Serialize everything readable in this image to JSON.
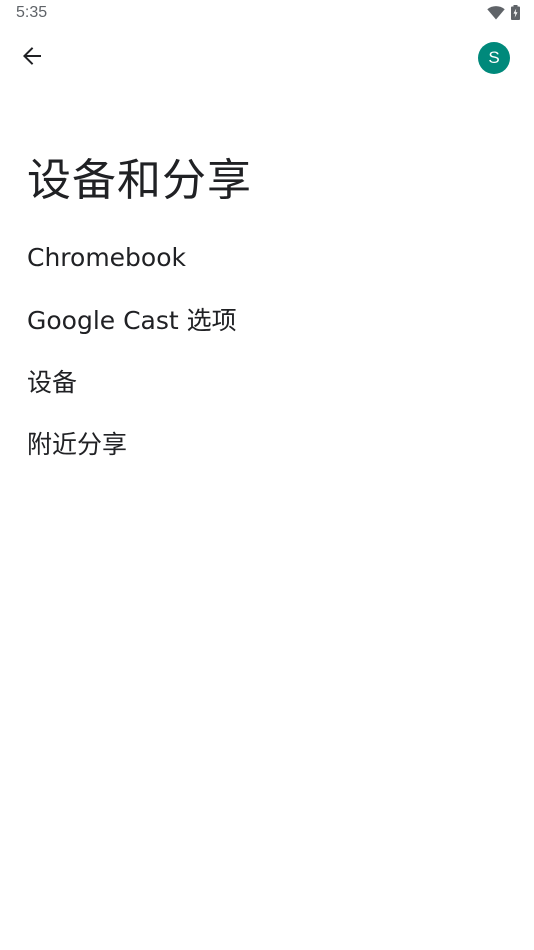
{
  "status_bar": {
    "time": "5:35",
    "icons": [
      "wifi-icon",
      "battery-charging-icon"
    ]
  },
  "app_bar": {
    "back_icon": "arrow-back-icon",
    "avatar_letter": "S",
    "avatar_color": "#00897b"
  },
  "page": {
    "title": "设备和分享"
  },
  "settings": {
    "items": [
      {
        "label": "Chromebook"
      },
      {
        "label": "Google Cast 选项"
      },
      {
        "label": "设备"
      },
      {
        "label": "附近分享"
      }
    ]
  }
}
